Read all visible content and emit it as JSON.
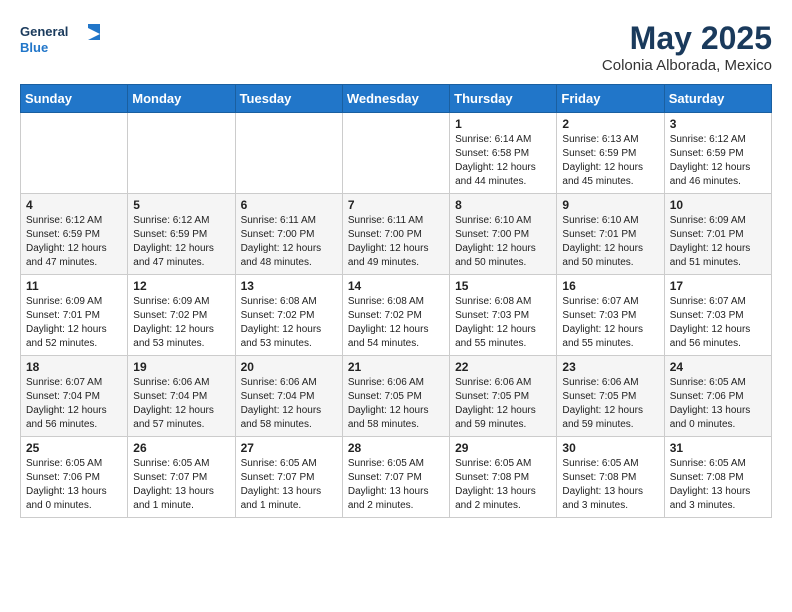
{
  "header": {
    "logo_line1": "General",
    "logo_line2": "Blue",
    "month_title": "May 2025",
    "location": "Colonia Alborada, Mexico"
  },
  "days_of_week": [
    "Sunday",
    "Monday",
    "Tuesday",
    "Wednesday",
    "Thursday",
    "Friday",
    "Saturday"
  ],
  "weeks": [
    [
      {
        "day": "",
        "info": ""
      },
      {
        "day": "",
        "info": ""
      },
      {
        "day": "",
        "info": ""
      },
      {
        "day": "",
        "info": ""
      },
      {
        "day": "1",
        "info": "Sunrise: 6:14 AM\nSunset: 6:58 PM\nDaylight: 12 hours\nand 44 minutes."
      },
      {
        "day": "2",
        "info": "Sunrise: 6:13 AM\nSunset: 6:59 PM\nDaylight: 12 hours\nand 45 minutes."
      },
      {
        "day": "3",
        "info": "Sunrise: 6:12 AM\nSunset: 6:59 PM\nDaylight: 12 hours\nand 46 minutes."
      }
    ],
    [
      {
        "day": "4",
        "info": "Sunrise: 6:12 AM\nSunset: 6:59 PM\nDaylight: 12 hours\nand 47 minutes."
      },
      {
        "day": "5",
        "info": "Sunrise: 6:12 AM\nSunset: 6:59 PM\nDaylight: 12 hours\nand 47 minutes."
      },
      {
        "day": "6",
        "info": "Sunrise: 6:11 AM\nSunset: 7:00 PM\nDaylight: 12 hours\nand 48 minutes."
      },
      {
        "day": "7",
        "info": "Sunrise: 6:11 AM\nSunset: 7:00 PM\nDaylight: 12 hours\nand 49 minutes."
      },
      {
        "day": "8",
        "info": "Sunrise: 6:10 AM\nSunset: 7:00 PM\nDaylight: 12 hours\nand 50 minutes."
      },
      {
        "day": "9",
        "info": "Sunrise: 6:10 AM\nSunset: 7:01 PM\nDaylight: 12 hours\nand 50 minutes."
      },
      {
        "day": "10",
        "info": "Sunrise: 6:09 AM\nSunset: 7:01 PM\nDaylight: 12 hours\nand 51 minutes."
      }
    ],
    [
      {
        "day": "11",
        "info": "Sunrise: 6:09 AM\nSunset: 7:01 PM\nDaylight: 12 hours\nand 52 minutes."
      },
      {
        "day": "12",
        "info": "Sunrise: 6:09 AM\nSunset: 7:02 PM\nDaylight: 12 hours\nand 53 minutes."
      },
      {
        "day": "13",
        "info": "Sunrise: 6:08 AM\nSunset: 7:02 PM\nDaylight: 12 hours\nand 53 minutes."
      },
      {
        "day": "14",
        "info": "Sunrise: 6:08 AM\nSunset: 7:02 PM\nDaylight: 12 hours\nand 54 minutes."
      },
      {
        "day": "15",
        "info": "Sunrise: 6:08 AM\nSunset: 7:03 PM\nDaylight: 12 hours\nand 55 minutes."
      },
      {
        "day": "16",
        "info": "Sunrise: 6:07 AM\nSunset: 7:03 PM\nDaylight: 12 hours\nand 55 minutes."
      },
      {
        "day": "17",
        "info": "Sunrise: 6:07 AM\nSunset: 7:03 PM\nDaylight: 12 hours\nand 56 minutes."
      }
    ],
    [
      {
        "day": "18",
        "info": "Sunrise: 6:07 AM\nSunset: 7:04 PM\nDaylight: 12 hours\nand 56 minutes."
      },
      {
        "day": "19",
        "info": "Sunrise: 6:06 AM\nSunset: 7:04 PM\nDaylight: 12 hours\nand 57 minutes."
      },
      {
        "day": "20",
        "info": "Sunrise: 6:06 AM\nSunset: 7:04 PM\nDaylight: 12 hours\nand 58 minutes."
      },
      {
        "day": "21",
        "info": "Sunrise: 6:06 AM\nSunset: 7:05 PM\nDaylight: 12 hours\nand 58 minutes."
      },
      {
        "day": "22",
        "info": "Sunrise: 6:06 AM\nSunset: 7:05 PM\nDaylight: 12 hours\nand 59 minutes."
      },
      {
        "day": "23",
        "info": "Sunrise: 6:06 AM\nSunset: 7:05 PM\nDaylight: 12 hours\nand 59 minutes."
      },
      {
        "day": "24",
        "info": "Sunrise: 6:05 AM\nSunset: 7:06 PM\nDaylight: 13 hours\nand 0 minutes."
      }
    ],
    [
      {
        "day": "25",
        "info": "Sunrise: 6:05 AM\nSunset: 7:06 PM\nDaylight: 13 hours\nand 0 minutes."
      },
      {
        "day": "26",
        "info": "Sunrise: 6:05 AM\nSunset: 7:07 PM\nDaylight: 13 hours\nand 1 minute."
      },
      {
        "day": "27",
        "info": "Sunrise: 6:05 AM\nSunset: 7:07 PM\nDaylight: 13 hours\nand 1 minute."
      },
      {
        "day": "28",
        "info": "Sunrise: 6:05 AM\nSunset: 7:07 PM\nDaylight: 13 hours\nand 2 minutes."
      },
      {
        "day": "29",
        "info": "Sunrise: 6:05 AM\nSunset: 7:08 PM\nDaylight: 13 hours\nand 2 minutes."
      },
      {
        "day": "30",
        "info": "Sunrise: 6:05 AM\nSunset: 7:08 PM\nDaylight: 13 hours\nand 3 minutes."
      },
      {
        "day": "31",
        "info": "Sunrise: 6:05 AM\nSunset: 7:08 PM\nDaylight: 13 hours\nand 3 minutes."
      }
    ]
  ]
}
